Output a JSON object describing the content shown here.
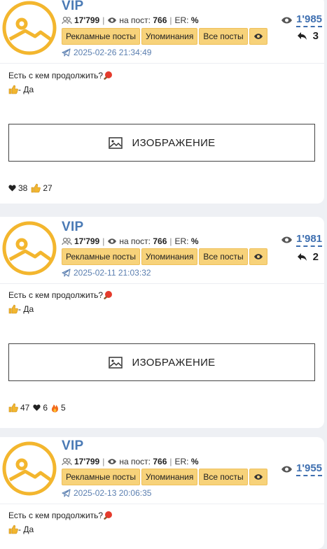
{
  "posts": [
    {
      "channel_name": "VIP",
      "subscribers": "17'799",
      "views_per_post_label": "на пост:",
      "views_per_post": "766",
      "er_label": "ER:",
      "er_value": "%",
      "buttons": {
        "ads": "Рекламные посты",
        "mentions": "Упоминания",
        "all": "Все посты"
      },
      "date": "2025-02-26 21:34:49",
      "views": "1'985",
      "forwards": "3",
      "text_line1": "Есть с кем продолжить?",
      "text_line2": "- Да",
      "image_label": "ИЗОБРАЖЕНИЕ",
      "reactions": [
        {
          "icon": "heart-icon",
          "count": "38"
        },
        {
          "icon": "thumbs-up-icon",
          "count": "27"
        }
      ]
    },
    {
      "channel_name": "VIP",
      "subscribers": "17'799",
      "views_per_post_label": "на пост:",
      "views_per_post": "766",
      "er_label": "ER:",
      "er_value": "%",
      "buttons": {
        "ads": "Рекламные посты",
        "mentions": "Упоминания",
        "all": "Все посты"
      },
      "date": "2025-02-11 21:03:32",
      "views": "1'981",
      "forwards": "2",
      "text_line1": "Есть с кем продолжить?",
      "text_line2": "- Да",
      "image_label": "ИЗОБРАЖЕНИЕ",
      "reactions": [
        {
          "icon": "thumbs-up-icon",
          "count": "47"
        },
        {
          "icon": "heart-icon",
          "count": "6"
        },
        {
          "icon": "fire-icon",
          "count": "5"
        }
      ]
    },
    {
      "channel_name": "VIP",
      "subscribers": "17'799",
      "views_per_post_label": "на пост:",
      "views_per_post": "766",
      "er_label": "ER:",
      "er_value": "%",
      "buttons": {
        "ads": "Рекламные посты",
        "mentions": "Упоминания",
        "all": "Все посты"
      },
      "date": "2025-02-13 20:06:35",
      "views": "1'955",
      "text_line1": "Есть с кем продолжить?",
      "text_line2": "- Да"
    }
  ],
  "colors": {
    "accent_blue": "#3e6fb0",
    "button_yellow": "#f7d27a",
    "avatar_yellow": "#f3b62e"
  }
}
